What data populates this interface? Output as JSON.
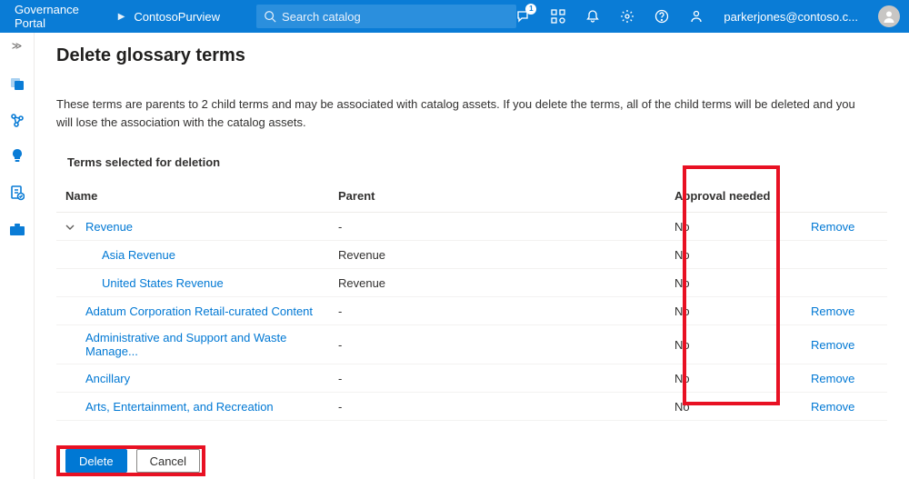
{
  "header": {
    "brand1": "Governance Portal",
    "brand2": "ContosoPurview",
    "search_placeholder": "Search catalog",
    "feedback_badge": "1",
    "user_email": "parkerjones@contoso.c..."
  },
  "page": {
    "title": "Delete glossary terms",
    "description": "These terms are parents to 2 child terms and may be associated with catalog assets. If you delete the terms, all of the child terms will be deleted and you will lose the association with the catalog assets.",
    "section_label": "Terms selected for deletion"
  },
  "table": {
    "headers": {
      "name": "Name",
      "parent": "Parent",
      "approval": "Approval needed"
    },
    "remove_label": "Remove",
    "rows": [
      {
        "name": "Revenue",
        "parent": "-",
        "approval": "No",
        "indent": 0,
        "expandable": true,
        "removable": true
      },
      {
        "name": "Asia Revenue",
        "parent": "Revenue",
        "approval": "No",
        "indent": 1,
        "expandable": false,
        "removable": false
      },
      {
        "name": "United States Revenue",
        "parent": "Revenue",
        "approval": "No",
        "indent": 1,
        "expandable": false,
        "removable": false
      },
      {
        "name": "Adatum Corporation Retail-curated Content",
        "parent": "-",
        "approval": "No",
        "indent": 0,
        "expandable": false,
        "removable": true
      },
      {
        "name": "Administrative and Support and Waste Manage...",
        "parent": "-",
        "approval": "No",
        "indent": 0,
        "expandable": false,
        "removable": true
      },
      {
        "name": "Ancillary",
        "parent": "-",
        "approval": "No",
        "indent": 0,
        "expandable": false,
        "removable": true
      },
      {
        "name": "Arts, Entertainment, and Recreation",
        "parent": "-",
        "approval": "No",
        "indent": 0,
        "expandable": false,
        "removable": true
      }
    ]
  },
  "buttons": {
    "delete": "Delete",
    "cancel": "Cancel"
  }
}
